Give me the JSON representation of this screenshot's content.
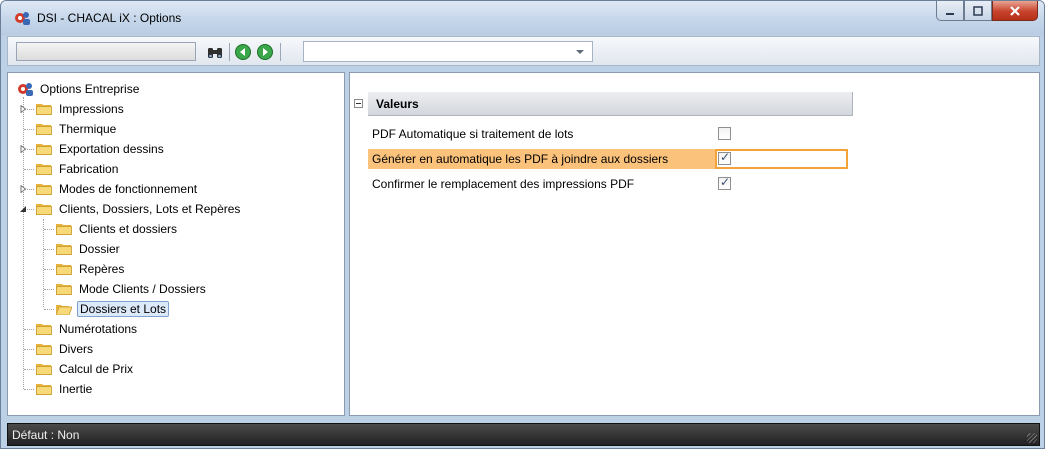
{
  "window": {
    "title": "DSI - CHACAL iX : Options",
    "app_icon": "app-gear-people-icon"
  },
  "toolbar": {
    "search_value": "",
    "find_icon": "binoculars-icon",
    "back_icon": "back-arrow-icon",
    "forward_icon": "forward-arrow-icon",
    "combo_value": ""
  },
  "tree": {
    "root": "Options Entreprise",
    "items": [
      {
        "label": "Impressions",
        "expandable": true
      },
      {
        "label": "Thermique",
        "expandable": false
      },
      {
        "label": "Exportation dessins",
        "expandable": true
      },
      {
        "label": "Fabrication",
        "expandable": false
      },
      {
        "label": "Modes de fonctionnement",
        "expandable": true
      },
      {
        "label": "Clients, Dossiers, Lots et Repères",
        "expandable": true,
        "expanded": true
      },
      {
        "label": "Clients et dossiers",
        "child": true
      },
      {
        "label": "Dossier",
        "child": true
      },
      {
        "label": "Repères",
        "child": true
      },
      {
        "label": "Mode Clients / Dossiers",
        "child": true
      },
      {
        "label": "Dossiers et Lots",
        "child": true,
        "selected": true
      },
      {
        "label": "Numérotations"
      },
      {
        "label": "Divers"
      },
      {
        "label": "Calcul de Prix"
      },
      {
        "label": "Inertie"
      }
    ]
  },
  "properties": {
    "section_title": "Valeurs",
    "rows": [
      {
        "label": "PDF Automatique si traitement de lots",
        "checked": false
      },
      {
        "label": "Générer en automatique les PDF à joindre aux dossiers",
        "checked": true
      },
      {
        "label": "Confirmer le remplacement des impressions PDF",
        "checked": true
      }
    ]
  },
  "status": {
    "text": "Défaut : Non"
  },
  "colors": {
    "highlight": "#fbc27c",
    "highlight_border": "#f2a33a",
    "selection": "#dce9f9"
  }
}
